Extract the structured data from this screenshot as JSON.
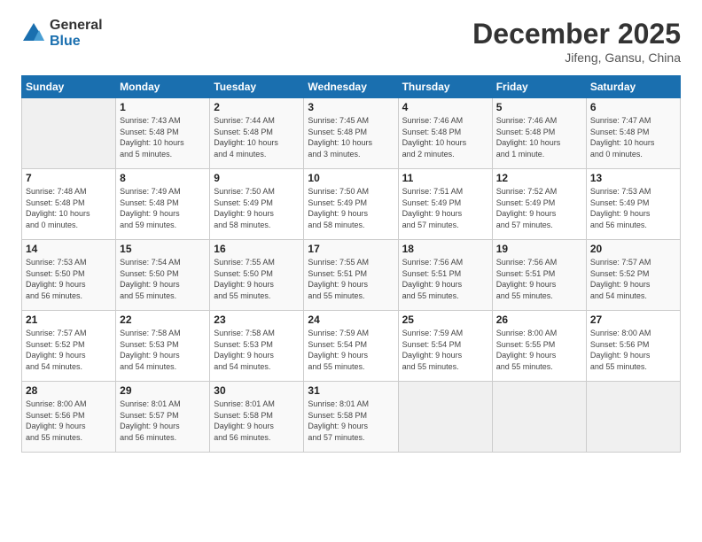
{
  "logo": {
    "general": "General",
    "blue": "Blue"
  },
  "title": "December 2025",
  "subtitle": "Jifeng, Gansu, China",
  "headers": [
    "Sunday",
    "Monday",
    "Tuesday",
    "Wednesday",
    "Thursday",
    "Friday",
    "Saturday"
  ],
  "weeks": [
    [
      {
        "day": "",
        "info": ""
      },
      {
        "day": "1",
        "info": "Sunrise: 7:43 AM\nSunset: 5:48 PM\nDaylight: 10 hours\nand 5 minutes."
      },
      {
        "day": "2",
        "info": "Sunrise: 7:44 AM\nSunset: 5:48 PM\nDaylight: 10 hours\nand 4 minutes."
      },
      {
        "day": "3",
        "info": "Sunrise: 7:45 AM\nSunset: 5:48 PM\nDaylight: 10 hours\nand 3 minutes."
      },
      {
        "day": "4",
        "info": "Sunrise: 7:46 AM\nSunset: 5:48 PM\nDaylight: 10 hours\nand 2 minutes."
      },
      {
        "day": "5",
        "info": "Sunrise: 7:46 AM\nSunset: 5:48 PM\nDaylight: 10 hours\nand 1 minute."
      },
      {
        "day": "6",
        "info": "Sunrise: 7:47 AM\nSunset: 5:48 PM\nDaylight: 10 hours\nand 0 minutes."
      }
    ],
    [
      {
        "day": "7",
        "info": "Sunrise: 7:48 AM\nSunset: 5:48 PM\nDaylight: 10 hours\nand 0 minutes."
      },
      {
        "day": "8",
        "info": "Sunrise: 7:49 AM\nSunset: 5:48 PM\nDaylight: 9 hours\nand 59 minutes."
      },
      {
        "day": "9",
        "info": "Sunrise: 7:50 AM\nSunset: 5:49 PM\nDaylight: 9 hours\nand 58 minutes."
      },
      {
        "day": "10",
        "info": "Sunrise: 7:50 AM\nSunset: 5:49 PM\nDaylight: 9 hours\nand 58 minutes."
      },
      {
        "day": "11",
        "info": "Sunrise: 7:51 AM\nSunset: 5:49 PM\nDaylight: 9 hours\nand 57 minutes."
      },
      {
        "day": "12",
        "info": "Sunrise: 7:52 AM\nSunset: 5:49 PM\nDaylight: 9 hours\nand 57 minutes."
      },
      {
        "day": "13",
        "info": "Sunrise: 7:53 AM\nSunset: 5:49 PM\nDaylight: 9 hours\nand 56 minutes."
      }
    ],
    [
      {
        "day": "14",
        "info": "Sunrise: 7:53 AM\nSunset: 5:50 PM\nDaylight: 9 hours\nand 56 minutes."
      },
      {
        "day": "15",
        "info": "Sunrise: 7:54 AM\nSunset: 5:50 PM\nDaylight: 9 hours\nand 55 minutes."
      },
      {
        "day": "16",
        "info": "Sunrise: 7:55 AM\nSunset: 5:50 PM\nDaylight: 9 hours\nand 55 minutes."
      },
      {
        "day": "17",
        "info": "Sunrise: 7:55 AM\nSunset: 5:51 PM\nDaylight: 9 hours\nand 55 minutes."
      },
      {
        "day": "18",
        "info": "Sunrise: 7:56 AM\nSunset: 5:51 PM\nDaylight: 9 hours\nand 55 minutes."
      },
      {
        "day": "19",
        "info": "Sunrise: 7:56 AM\nSunset: 5:51 PM\nDaylight: 9 hours\nand 55 minutes."
      },
      {
        "day": "20",
        "info": "Sunrise: 7:57 AM\nSunset: 5:52 PM\nDaylight: 9 hours\nand 54 minutes."
      }
    ],
    [
      {
        "day": "21",
        "info": "Sunrise: 7:57 AM\nSunset: 5:52 PM\nDaylight: 9 hours\nand 54 minutes."
      },
      {
        "day": "22",
        "info": "Sunrise: 7:58 AM\nSunset: 5:53 PM\nDaylight: 9 hours\nand 54 minutes."
      },
      {
        "day": "23",
        "info": "Sunrise: 7:58 AM\nSunset: 5:53 PM\nDaylight: 9 hours\nand 54 minutes."
      },
      {
        "day": "24",
        "info": "Sunrise: 7:59 AM\nSunset: 5:54 PM\nDaylight: 9 hours\nand 55 minutes."
      },
      {
        "day": "25",
        "info": "Sunrise: 7:59 AM\nSunset: 5:54 PM\nDaylight: 9 hours\nand 55 minutes."
      },
      {
        "day": "26",
        "info": "Sunrise: 8:00 AM\nSunset: 5:55 PM\nDaylight: 9 hours\nand 55 minutes."
      },
      {
        "day": "27",
        "info": "Sunrise: 8:00 AM\nSunset: 5:56 PM\nDaylight: 9 hours\nand 55 minutes."
      }
    ],
    [
      {
        "day": "28",
        "info": "Sunrise: 8:00 AM\nSunset: 5:56 PM\nDaylight: 9 hours\nand 55 minutes."
      },
      {
        "day": "29",
        "info": "Sunrise: 8:01 AM\nSunset: 5:57 PM\nDaylight: 9 hours\nand 56 minutes."
      },
      {
        "day": "30",
        "info": "Sunrise: 8:01 AM\nSunset: 5:58 PM\nDaylight: 9 hours\nand 56 minutes."
      },
      {
        "day": "31",
        "info": "Sunrise: 8:01 AM\nSunset: 5:58 PM\nDaylight: 9 hours\nand 57 minutes."
      },
      {
        "day": "",
        "info": ""
      },
      {
        "day": "",
        "info": ""
      },
      {
        "day": "",
        "info": ""
      }
    ]
  ]
}
